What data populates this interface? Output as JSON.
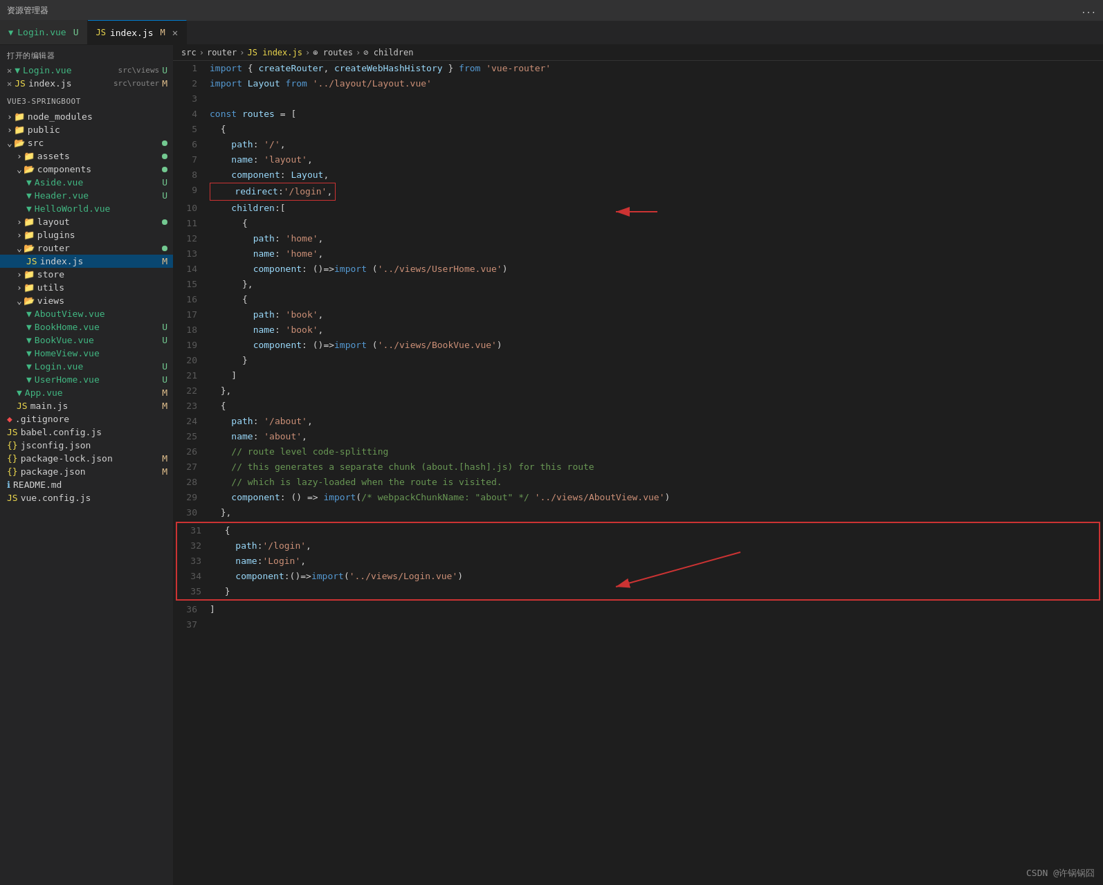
{
  "titleBar": {
    "text": "资源管理器",
    "dotsLabel": "..."
  },
  "openFilesLabel": "打开的编辑器",
  "tabs": [
    {
      "id": "login-vue",
      "icon": "vue",
      "label": "Login.vue",
      "path": "src\\views",
      "badge": "U",
      "active": false
    },
    {
      "id": "index-js",
      "icon": "js",
      "label": "index.js",
      "path": "src\\router",
      "badge": "M",
      "active": true,
      "hasClose": true
    }
  ],
  "breadcrumb": {
    "parts": [
      "src",
      "router",
      "index.js",
      "routes",
      "children"
    ]
  },
  "projectName": "VUE3-SPRINGBOOT",
  "sidebar": {
    "items": [
      {
        "type": "folder",
        "label": "node_modules",
        "indent": 10,
        "collapsed": true,
        "hasDot": false
      },
      {
        "type": "folder",
        "label": "public",
        "indent": 10,
        "collapsed": true,
        "hasDot": false
      },
      {
        "type": "folder",
        "label": "src",
        "indent": 10,
        "collapsed": false,
        "hasDot": true,
        "dotColor": "green"
      },
      {
        "type": "folder",
        "label": "assets",
        "indent": 24,
        "collapsed": true,
        "hasDot": true,
        "dotColor": "green"
      },
      {
        "type": "folder",
        "label": "components",
        "indent": 24,
        "collapsed": false,
        "hasDot": true,
        "dotColor": "green"
      },
      {
        "type": "vue",
        "label": "Aside.vue",
        "indent": 38,
        "badge": "U"
      },
      {
        "type": "vue",
        "label": "Header.vue",
        "indent": 38,
        "badge": "U"
      },
      {
        "type": "vue",
        "label": "HelloWorld.vue",
        "indent": 38
      },
      {
        "type": "folder",
        "label": "layout",
        "indent": 24,
        "collapsed": true,
        "hasDot": true,
        "dotColor": "green"
      },
      {
        "type": "folder",
        "label": "plugins",
        "indent": 24,
        "collapsed": true,
        "hasDot": false
      },
      {
        "type": "folder",
        "label": "router",
        "indent": 24,
        "collapsed": false,
        "hasDot": true,
        "dotColor": "green"
      },
      {
        "type": "js",
        "label": "index.js",
        "indent": 38,
        "badge": "M",
        "selected": true
      },
      {
        "type": "folder",
        "label": "store",
        "indent": 24,
        "collapsed": true,
        "hasDot": false
      },
      {
        "type": "folder",
        "label": "utils",
        "indent": 24,
        "collapsed": true,
        "hasDot": false
      },
      {
        "type": "folder",
        "label": "views",
        "indent": 24,
        "collapsed": false,
        "hasDot": false
      },
      {
        "type": "vue",
        "label": "AboutView.vue",
        "indent": 38
      },
      {
        "type": "vue",
        "label": "BookHome.vue",
        "indent": 38,
        "badge": "U"
      },
      {
        "type": "vue",
        "label": "BookVue.vue",
        "indent": 38,
        "badge": "U"
      },
      {
        "type": "vue",
        "label": "HomeView.vue",
        "indent": 38
      },
      {
        "type": "vue",
        "label": "Login.vue",
        "indent": 38,
        "badge": "U"
      },
      {
        "type": "vue",
        "label": "UserHome.vue",
        "indent": 38,
        "badge": "U"
      },
      {
        "type": "vue",
        "label": "App.vue",
        "indent": 24,
        "badge": "M"
      },
      {
        "type": "js",
        "label": "main.js",
        "indent": 24,
        "badge": "M"
      },
      {
        "type": "git",
        "label": ".gitignore",
        "indent": 10
      },
      {
        "type": "js",
        "label": "babel.config.js",
        "indent": 10
      },
      {
        "type": "js",
        "label": "jsconfig.json",
        "indent": 10
      },
      {
        "type": "json",
        "label": "package-lock.json",
        "indent": 10,
        "badge": "M"
      },
      {
        "type": "json",
        "label": "package.json",
        "indent": 10,
        "badge": "M"
      },
      {
        "type": "md",
        "label": "README.md",
        "indent": 10
      },
      {
        "type": "js",
        "label": "vue.config.js",
        "indent": 10
      }
    ]
  },
  "code": {
    "lines": [
      {
        "num": 1,
        "content": "import { createRouter, createWebHashHistory } from 'vue-router'"
      },
      {
        "num": 2,
        "content": "import Layout from '../layout/Layout.vue'"
      },
      {
        "num": 3,
        "content": ""
      },
      {
        "num": 4,
        "content": "const routes = ["
      },
      {
        "num": 5,
        "content": "  {"
      },
      {
        "num": 6,
        "content": "    path: '/',"
      },
      {
        "num": 7,
        "content": "    name: 'layout',"
      },
      {
        "num": 8,
        "content": "    component: Layout,"
      },
      {
        "num": 9,
        "content": "    redirect:'/login',",
        "redBox": true
      },
      {
        "num": 10,
        "content": "    children:["
      },
      {
        "num": 11,
        "content": "      {"
      },
      {
        "num": 12,
        "content": "        path: 'home',"
      },
      {
        "num": 13,
        "content": "        name: 'home',"
      },
      {
        "num": 14,
        "content": "        component: ()=>import ('../views/UserHome.vue')"
      },
      {
        "num": 15,
        "content": "      },"
      },
      {
        "num": 16,
        "content": "      {"
      },
      {
        "num": 17,
        "content": "        path: 'book',"
      },
      {
        "num": 18,
        "content": "        name: 'book',"
      },
      {
        "num": 19,
        "content": "        component: ()=>import ('../views/BookVue.vue')"
      },
      {
        "num": 20,
        "content": "      }"
      },
      {
        "num": 21,
        "content": "    ]"
      },
      {
        "num": 22,
        "content": "  },"
      },
      {
        "num": 23,
        "content": "  {"
      },
      {
        "num": 24,
        "content": "    path: '/about',"
      },
      {
        "num": 25,
        "content": "    name: 'about',"
      },
      {
        "num": 26,
        "content": "    // route level code-splitting"
      },
      {
        "num": 27,
        "content": "    // this generates a separate chunk (about.[hash].js) for this route"
      },
      {
        "num": 28,
        "content": "    // which is lazy-loaded when the route is visited."
      },
      {
        "num": 29,
        "content": "    component: () => import(/* webpackChunkName: \"about\" */ '../views/AboutView.vue')"
      },
      {
        "num": 30,
        "content": "  },"
      },
      {
        "num": 31,
        "content": "  {",
        "redBoxStart": true
      },
      {
        "num": 32,
        "content": "    path:'/login',"
      },
      {
        "num": 33,
        "content": "    name:'Login',"
      },
      {
        "num": 34,
        "content": "    component:()=>import('../views/Login.vue')"
      },
      {
        "num": 35,
        "content": "  }",
        "redBoxEnd": true
      },
      {
        "num": 36,
        "content": "]"
      }
    ]
  },
  "watermark": "CSDN @许锅锅囧"
}
